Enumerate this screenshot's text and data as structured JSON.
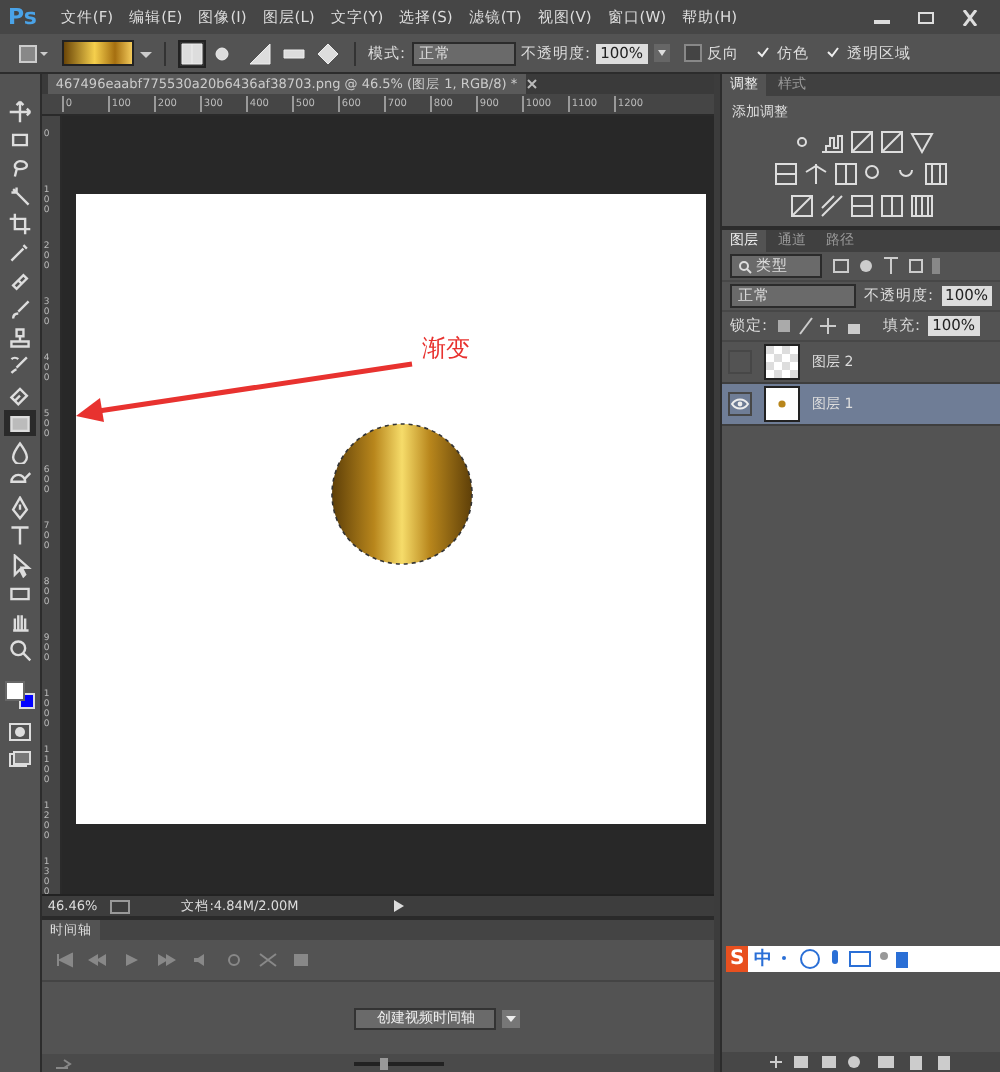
{
  "app_logo": "Ps",
  "menu": [
    "文件(F)",
    "编辑(E)",
    "图像(I)",
    "图层(L)",
    "文字(Y)",
    "选择(S)",
    "滤镜(T)",
    "视图(V)",
    "窗口(W)",
    "帮助(H)"
  ],
  "options_bar": {
    "gradient_types": [
      {
        "kind": "linear",
        "selected": true
      },
      {
        "kind": "radial",
        "selected": false
      },
      {
        "kind": "angle",
        "selected": false
      },
      {
        "kind": "reflected",
        "selected": false
      },
      {
        "kind": "diamond",
        "selected": false
      }
    ],
    "mode_label": "模式:",
    "mode_value": "正常",
    "opacity_label": "不透明度:",
    "opacity_value": "100%",
    "checks": [
      {
        "label": "反向",
        "checked": false
      },
      {
        "label": "仿色",
        "checked": true
      },
      {
        "label": "透明区域",
        "checked": true
      }
    ]
  },
  "tools": [
    {
      "kind": "move",
      "selected": false
    },
    {
      "kind": "marquee",
      "selected": false
    },
    {
      "kind": "lasso",
      "selected": false
    },
    {
      "kind": "quick-select",
      "selected": false
    },
    {
      "kind": "crop",
      "selected": false
    },
    {
      "kind": "eyedropper",
      "selected": false
    },
    {
      "kind": "healing",
      "selected": false
    },
    {
      "kind": "brush",
      "selected": false
    },
    {
      "kind": "stamp",
      "selected": false
    },
    {
      "kind": "history-brush",
      "selected": false
    },
    {
      "kind": "eraser",
      "selected": false
    },
    {
      "kind": "gradient",
      "selected": true
    },
    {
      "kind": "blur",
      "selected": false
    },
    {
      "kind": "dodge",
      "selected": false
    },
    {
      "kind": "pen",
      "selected": false
    },
    {
      "kind": "type",
      "selected": false
    },
    {
      "kind": "path-select",
      "selected": false
    },
    {
      "kind": "shape",
      "selected": false
    },
    {
      "kind": "hand",
      "selected": false
    },
    {
      "kind": "zoom",
      "selected": false
    }
  ],
  "document": {
    "tab_title": "467496eaabf775530a20b6436af38703.png @ 46.5% (图层 1, RGB/8) *",
    "ruler_ticks": [
      "0",
      "100",
      "200",
      "300",
      "400",
      "500",
      "600",
      "700",
      "800",
      "900",
      "1000",
      "1100",
      "1200"
    ],
    "vertical_ruler_ticks": [
      "0",
      "100",
      "200",
      "300",
      "400",
      "500",
      "600",
      "700",
      "800",
      "900",
      "1000",
      "1100",
      "1200",
      "1300"
    ],
    "annotation": "渐变",
    "zoom": "46.46%",
    "doc_info": "文档:4.84M/2.00M"
  },
  "timeline": {
    "tab": "时间轴",
    "create_button": "创建视频时间轴",
    "zoom_slider": {
      "level": 0.3
    }
  },
  "adjustments": {
    "tabs": [
      {
        "label": "调整",
        "selected": true
      },
      {
        "label": "样式",
        "selected": false
      }
    ],
    "title": "添加调整"
  },
  "layers_panel": {
    "tabs": [
      {
        "label": "图层",
        "selected": true
      },
      {
        "label": "通道",
        "selected": false
      },
      {
        "label": "路径",
        "selected": false
      }
    ],
    "filter": "类型",
    "blend_mode": "正常",
    "opacity_label": "不透明度:",
    "opacity_value": "100%",
    "lock_label": "锁定:",
    "fill_label": "填充:",
    "fill_value": "100%",
    "layers": [
      {
        "name": "图层 2",
        "visible": false,
        "selected": false,
        "kind": "empty"
      },
      {
        "name": "图层 1",
        "visible": true,
        "selected": true,
        "kind": "content"
      }
    ]
  },
  "ime": {
    "logo": "S",
    "mode": "中"
  }
}
